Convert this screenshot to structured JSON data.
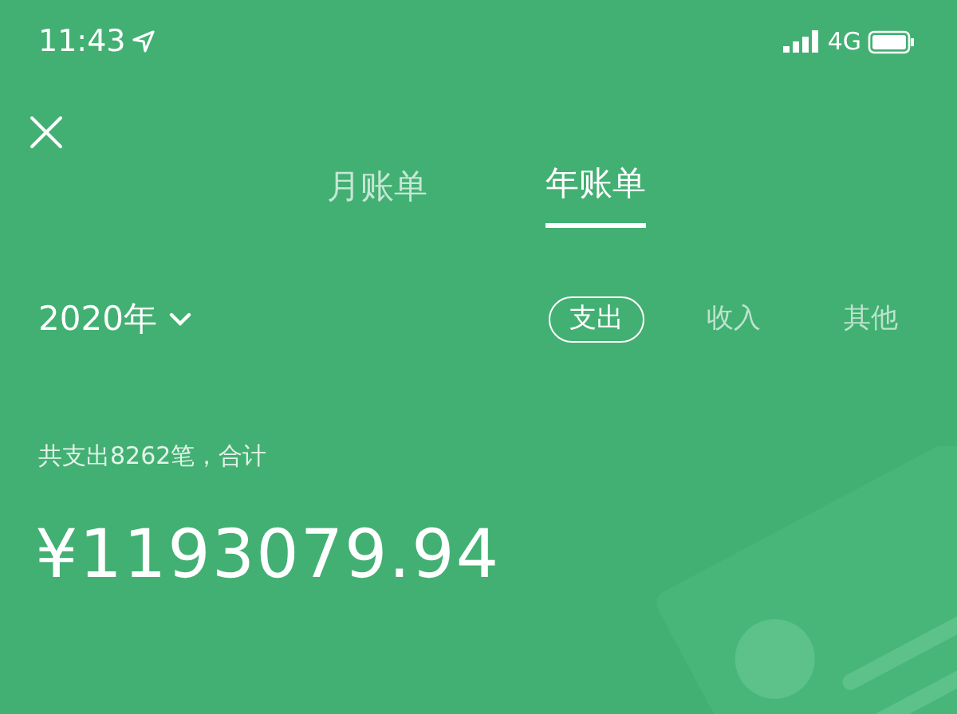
{
  "status_bar": {
    "time": "11:43",
    "network": "4G"
  },
  "tabs": [
    {
      "label": "月账单",
      "selected": false
    },
    {
      "label": "年账单",
      "selected": true
    }
  ],
  "year_selector": {
    "label": "2020年"
  },
  "filters": [
    {
      "label": "支出",
      "selected": true
    },
    {
      "label": "收入",
      "selected": false
    },
    {
      "label": "其他",
      "selected": false
    }
  ],
  "summary": {
    "text": "共支出8262笔，合计"
  },
  "total": {
    "amount": "¥1193079.94"
  }
}
